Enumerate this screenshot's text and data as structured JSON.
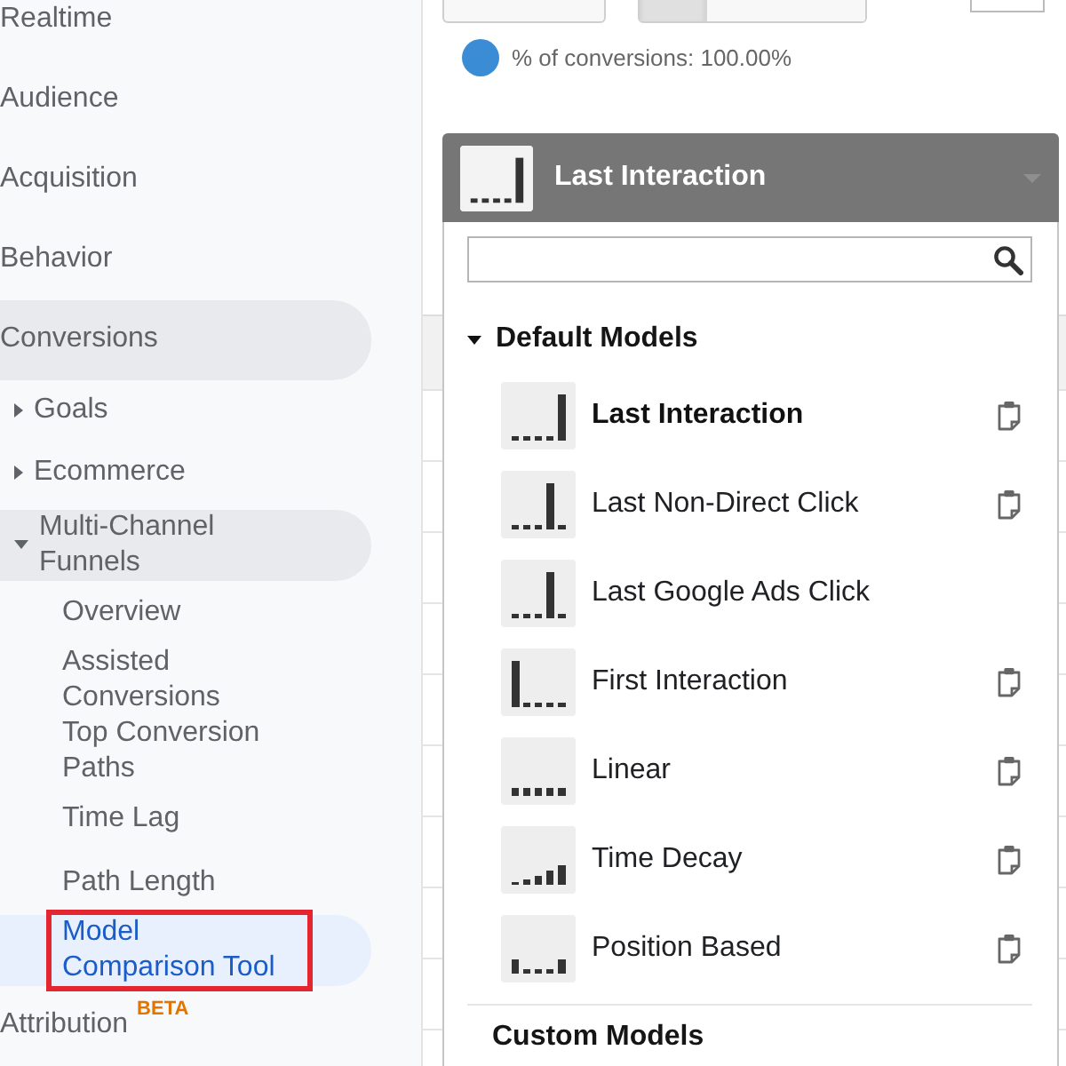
{
  "toolbar": [
    {
      "kind": "button"
    },
    {
      "kind": "segmented",
      "segments": [
        {
          "selected": true
        },
        {
          "selected": false
        }
      ]
    },
    {
      "kind": "field"
    }
  ],
  "legend": {
    "color": "#3a8dd4",
    "label": "% of conversions: 100.00%"
  },
  "sidebar": {
    "items": [
      {
        "label": "Realtime",
        "expanded": false
      },
      {
        "label": "Audience",
        "expanded": false
      },
      {
        "label": "Acquisition",
        "expanded": false
      },
      {
        "label": "Behavior",
        "expanded": false
      },
      {
        "label": "Conversions",
        "expanded": true,
        "children": [
          {
            "label": "Goals",
            "expanded": false
          },
          {
            "label": "Ecommerce",
            "expanded": false
          },
          {
            "label": "Multi-Channel Funnels",
            "expanded": true,
            "children": [
              {
                "label": "Overview",
                "selected": false,
                "outlined": false
              },
              {
                "label": "Assisted Conversions",
                "selected": false,
                "outlined": false
              },
              {
                "label": "Top Conversion Paths",
                "selected": false,
                "outlined": false
              },
              {
                "label": "Time Lag",
                "selected": false,
                "outlined": false
              },
              {
                "label": "Path Length",
                "selected": false,
                "outlined": false
              },
              {
                "label": "Model Comparison Tool",
                "selected": true,
                "outlined": true
              }
            ]
          }
        ]
      },
      {
        "label": "Attribution",
        "badge": "BETA",
        "expanded": false
      }
    ]
  },
  "model_picker": {
    "selected_model": {
      "label": "Last Interaction",
      "kind": "last"
    },
    "sections": [
      {
        "title": "Default Models",
        "expanded": true,
        "models": [
          {
            "label": "Last Interaction",
            "kind": "last",
            "selected": true,
            "copyable": true
          },
          {
            "label": "Last Non-Direct Click",
            "kind": "nearlast",
            "selected": false,
            "copyable": true
          },
          {
            "label": "Last Google Ads Click",
            "kind": "nearlast",
            "selected": false,
            "copyable": false
          },
          {
            "label": "First Interaction",
            "kind": "first",
            "selected": false,
            "copyable": true
          },
          {
            "label": "Linear",
            "kind": "linear",
            "selected": false,
            "copyable": true
          },
          {
            "label": "Time Decay",
            "kind": "decay",
            "selected": false,
            "copyable": true
          },
          {
            "label": "Position Based",
            "kind": "position",
            "selected": false,
            "copyable": true
          }
        ]
      },
      {
        "title": "Custom Models"
      }
    ]
  }
}
